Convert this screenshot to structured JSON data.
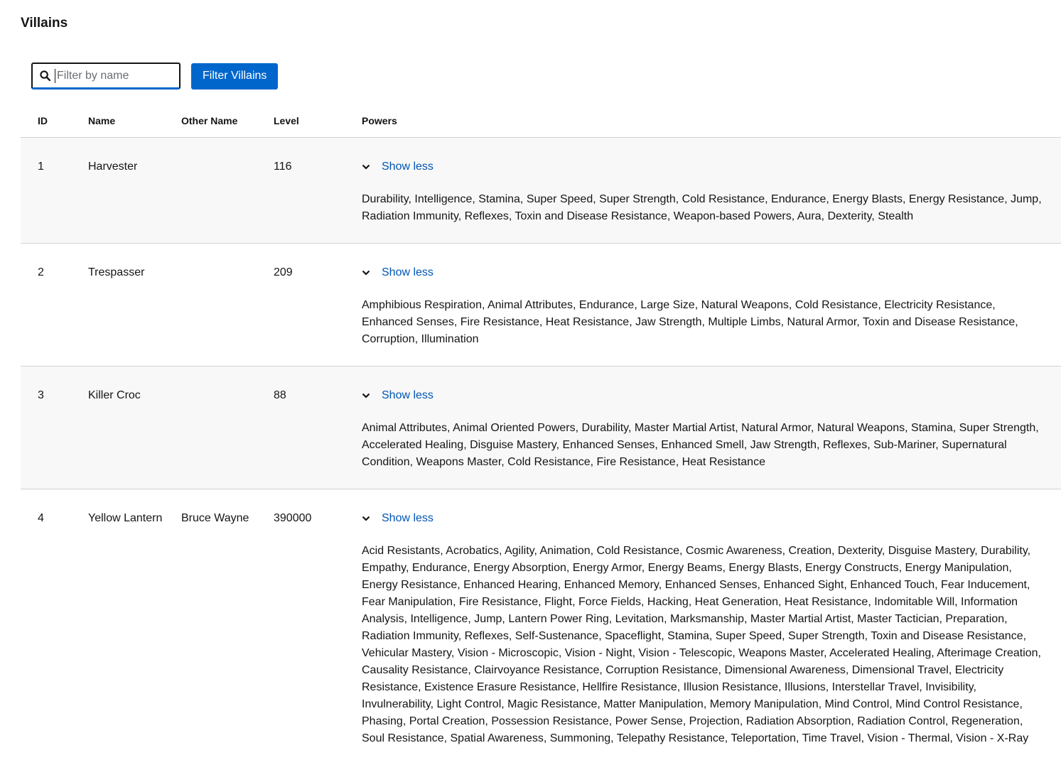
{
  "page": {
    "title": "Villains"
  },
  "toolbar": {
    "search_placeholder": "Filter by name",
    "filter_button_label": "Filter Villains"
  },
  "table": {
    "headers": {
      "id": "ID",
      "name": "Name",
      "other_name": "Other Name",
      "level": "Level",
      "powers": "Powers"
    },
    "rows": [
      {
        "id": "1",
        "name": "Harvester",
        "other_name": "",
        "level": "116",
        "toggle_label": "Show less",
        "powers": "Durability, Intelligence, Stamina, Super Speed, Super Strength, Cold Resistance, Endurance, Energy Blasts, Energy Resistance, Jump, Radiation Immunity, Reflexes, Toxin and Disease Resistance, Weapon-based Powers, Aura, Dexterity, Stealth"
      },
      {
        "id": "2",
        "name": "Trespasser",
        "other_name": "",
        "level": "209",
        "toggle_label": "Show less",
        "powers": "Amphibious Respiration, Animal Attributes, Endurance, Large Size, Natural Weapons, Cold Resistance, Electricity Resistance, Enhanced Senses, Fire Resistance, Heat Resistance, Jaw Strength, Multiple Limbs, Natural Armor, Toxin and Disease Resistance, Corruption, Illumination"
      },
      {
        "id": "3",
        "name": "Killer Croc",
        "other_name": "",
        "level": "88",
        "toggle_label": "Show less",
        "powers": "Animal Attributes, Animal Oriented Powers, Durability, Master Martial Artist, Natural Armor, Natural Weapons, Stamina, Super Strength, Accelerated Healing, Disguise Mastery, Enhanced Senses, Enhanced Smell, Jaw Strength, Reflexes, Sub-Mariner, Supernatural Condition, Weapons Master, Cold Resistance, Fire Resistance, Heat Resistance"
      },
      {
        "id": "4",
        "name": "Yellow Lantern",
        "other_name": "Bruce Wayne",
        "level": "390000",
        "toggle_label": "Show less",
        "powers": "Acid Resistants, Acrobatics, Agility, Animation, Cold Resistance, Cosmic Awareness, Creation, Dexterity, Disguise Mastery, Durability, Empathy, Endurance, Energy Absorption, Energy Armor, Energy Beams, Energy Blasts, Energy Constructs, Energy Manipulation, Energy Resistance, Enhanced Hearing, Enhanced Memory, Enhanced Senses, Enhanced Sight, Enhanced Touch, Fear Inducement, Fear Manipulation, Fire Resistance, Flight, Force Fields, Hacking, Heat Generation, Heat Resistance, Indomitable Will, Information Analysis, Intelligence, Jump, Lantern Power Ring, Levitation, Marksmanship, Master Martial Artist, Master Tactician, Preparation, Radiation Immunity, Reflexes, Self-Sustenance, Spaceflight, Stamina, Super Speed, Super Strength, Toxin and Disease Resistance, Vehicular Mastery, Vision - Microscopic, Vision - Night, Vision - Telescopic, Weapons Master, Accelerated Healing, Afterimage Creation, Causality Resistance, Clairvoyance Resistance, Corruption Resistance, Dimensional Awareness, Dimensional Travel, Electricity Resistance, Existence Erasure Resistance, Hellfire Resistance, Illusion Resistance, Illusions, Interstellar Travel, Invisibility, Invulnerability, Light Control, Magic Resistance, Matter Manipulation, Memory Manipulation, Mind Control, Mind Control Resistance, Phasing, Portal Creation, Possession Resistance, Power Sense, Projection, Radiation Absorption, Radiation Control, Regeneration, Soul Resistance, Spatial Awareness, Summoning, Telepathy Resistance, Teleportation, Time Travel, Vision - Thermal, Vision - X-Ray"
      }
    ]
  },
  "colors": {
    "accent": "#0066cc",
    "row_shade": "#f8f8f8",
    "divider": "#d2d2d2"
  }
}
